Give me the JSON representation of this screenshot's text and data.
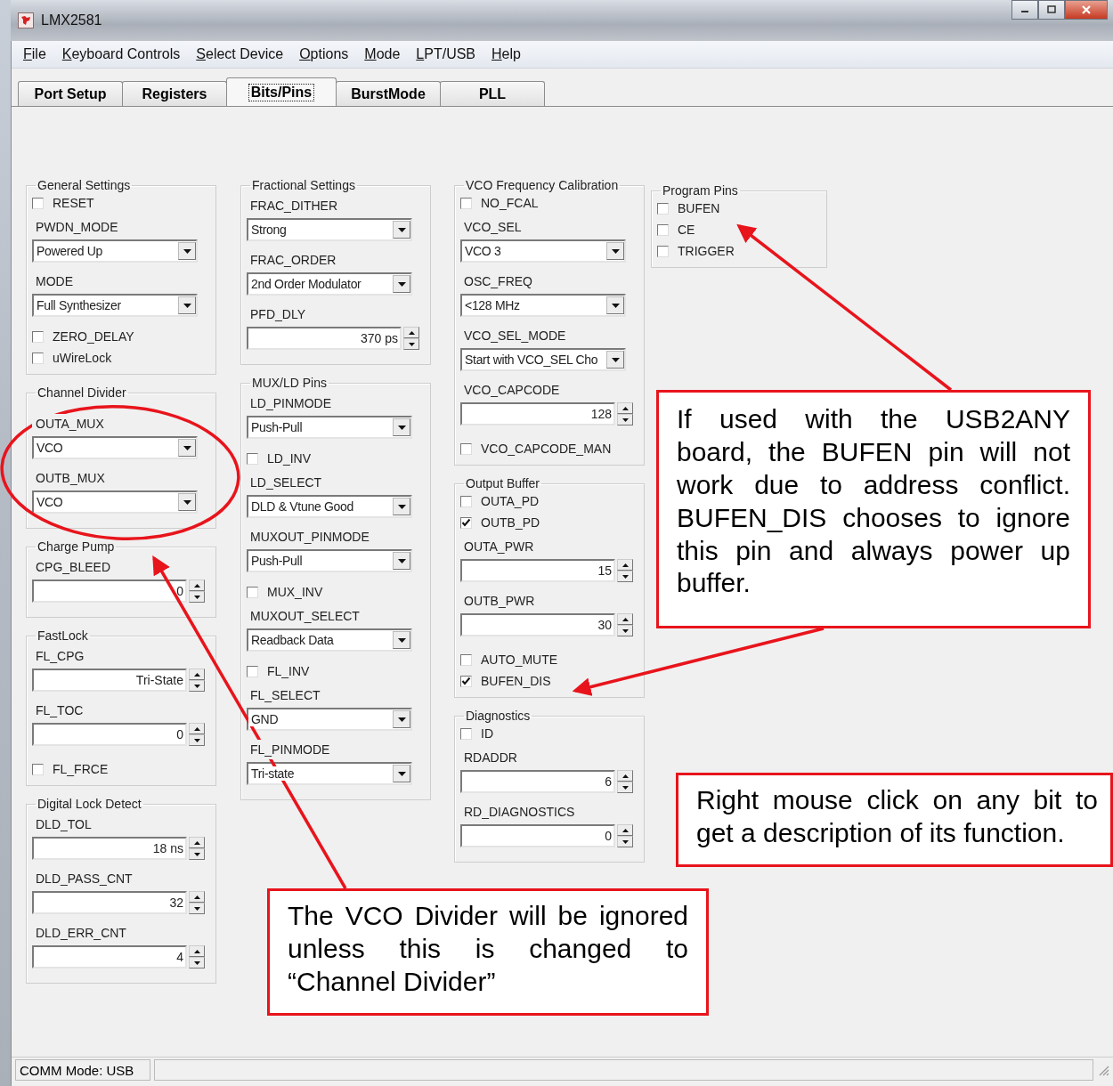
{
  "window": {
    "title": "LMX2581"
  },
  "menu": [
    {
      "label": "File"
    },
    {
      "label": "Keyboard Controls"
    },
    {
      "label": "Select Device"
    },
    {
      "label": "Options"
    },
    {
      "label": "Mode"
    },
    {
      "label": "LPT/USB"
    },
    {
      "label": "Help"
    }
  ],
  "tabs": [
    {
      "label": "Port Setup",
      "selected": false
    },
    {
      "label": "Registers",
      "selected": false
    },
    {
      "label": "Bits/Pins",
      "selected": true
    },
    {
      "label": "BurstMode",
      "selected": false
    },
    {
      "label": "PLL",
      "selected": false
    }
  ],
  "columns": [
    {
      "groups": [
        {
          "title": "General Settings",
          "items": [
            {
              "kind": "check",
              "label": "RESET",
              "checked": false
            },
            {
              "kind": "combo",
              "label": "PWDN_MODE",
              "value": "Powered Up"
            },
            {
              "kind": "combo",
              "label": "MODE",
              "value": "Full Synthesizer"
            },
            {
              "kind": "check",
              "label": "ZERO_DELAY",
              "checked": false
            },
            {
              "kind": "check",
              "label": "uWireLock",
              "checked": false
            }
          ]
        },
        {
          "title": "Channel Divider",
          "items": [
            {
              "kind": "combo",
              "label": "OUTA_MUX",
              "value": "VCO"
            },
            {
              "kind": "combo",
              "label": "OUTB_MUX",
              "value": "VCO"
            }
          ]
        },
        {
          "title": "Charge Pump",
          "items": [
            {
              "kind": "spin",
              "label": "CPG_BLEED",
              "value": "0"
            }
          ]
        },
        {
          "title": "FastLock",
          "items": [
            {
              "kind": "spin",
              "label": "FL_CPG",
              "value": "Tri-State"
            },
            {
              "kind": "spin",
              "label": "FL_TOC",
              "value": "0"
            },
            {
              "kind": "check",
              "label": "FL_FRCE",
              "checked": false
            }
          ]
        },
        {
          "title": "Digital Lock Detect",
          "items": [
            {
              "kind": "spin",
              "label": "DLD_TOL",
              "value": "18 ns"
            },
            {
              "kind": "spin",
              "label": "DLD_PASS_CNT",
              "value": "32"
            },
            {
              "kind": "spin",
              "label": "DLD_ERR_CNT",
              "value": "4"
            }
          ]
        }
      ]
    },
    {
      "groups": [
        {
          "title": "Fractional Settings",
          "items": [
            {
              "kind": "combo",
              "label": "FRAC_DITHER",
              "value": "Strong"
            },
            {
              "kind": "combo",
              "label": "FRAC_ORDER",
              "value": "2nd Order Modulator"
            },
            {
              "kind": "spin",
              "label": "PFD_DLY",
              "value": "370 ps"
            }
          ]
        },
        {
          "title": "MUX/LD Pins",
          "items": [
            {
              "kind": "combo",
              "label": "LD_PINMODE",
              "value": "Push-Pull"
            },
            {
              "kind": "check",
              "label": "LD_INV",
              "checked": false
            },
            {
              "kind": "combo",
              "label": "LD_SELECT",
              "value": "DLD & Vtune Good"
            },
            {
              "kind": "combo",
              "label": "MUXOUT_PINMODE",
              "value": "Push-Pull"
            },
            {
              "kind": "check",
              "label": "MUX_INV",
              "checked": false
            },
            {
              "kind": "combo",
              "label": "MUXOUT_SELECT",
              "value": "Readback Data"
            },
            {
              "kind": "check",
              "label": "FL_INV",
              "checked": false
            },
            {
              "kind": "combo",
              "label": "FL_SELECT",
              "value": "GND"
            },
            {
              "kind": "combo",
              "label": "FL_PINMODE",
              "value": "Tri-state"
            }
          ]
        }
      ]
    },
    {
      "groups": [
        {
          "title": "VCO Frequency Calibration",
          "items": [
            {
              "kind": "check",
              "label": "NO_FCAL",
              "checked": false
            },
            {
              "kind": "combo",
              "label": "VCO_SEL",
              "value": "VCO 3"
            },
            {
              "kind": "combo",
              "label": "OSC_FREQ",
              "value": "<128 MHz"
            },
            {
              "kind": "combo",
              "label": "VCO_SEL_MODE",
              "value": "Start with VCO_SEL Cho"
            },
            {
              "kind": "spin",
              "label": "VCO_CAPCODE",
              "value": "128"
            },
            {
              "kind": "check",
              "label": "VCO_CAPCODE_MAN",
              "checked": false
            }
          ]
        },
        {
          "title": "Output Buffer",
          "items": [
            {
              "kind": "check",
              "label": "OUTA_PD",
              "checked": false
            },
            {
              "kind": "check",
              "label": "OUTB_PD",
              "checked": true
            },
            {
              "kind": "spin",
              "label": "OUTA_PWR",
              "value": "15"
            },
            {
              "kind": "spin",
              "label": "OUTB_PWR",
              "value": "30"
            },
            {
              "kind": "check",
              "label": "AUTO_MUTE",
              "checked": false
            },
            {
              "kind": "check",
              "label": "BUFEN_DIS",
              "checked": true
            }
          ]
        },
        {
          "title": "Diagnostics",
          "items": [
            {
              "kind": "check",
              "label": "ID",
              "checked": false
            },
            {
              "kind": "spin",
              "label": "RDADDR",
              "value": "6"
            },
            {
              "kind": "spin",
              "label": "RD_DIAGNOSTICS",
              "value": "0"
            }
          ]
        }
      ]
    },
    {
      "groups": [
        {
          "title": "Program Pins",
          "items": [
            {
              "kind": "check",
              "label": "BUFEN",
              "checked": false
            },
            {
              "kind": "check",
              "label": "CE",
              "checked": false
            },
            {
              "kind": "check",
              "label": "TRIGGER",
              "checked": false
            }
          ]
        }
      ]
    }
  ],
  "callouts": [
    {
      "text": "If used with the USB2ANY board, the BUFEN pin will not work due to address conflict. BUFEN_DIS chooses to ignore this pin and always power up buffer."
    },
    {
      "text": "Right mouse click on any bit to get a description of its function."
    },
    {
      "text": "The VCO Divider will be ignored unless this is changed to “Channel Divider”"
    }
  ],
  "status_bar": [
    {
      "text": "COMM Mode: USB"
    }
  ]
}
